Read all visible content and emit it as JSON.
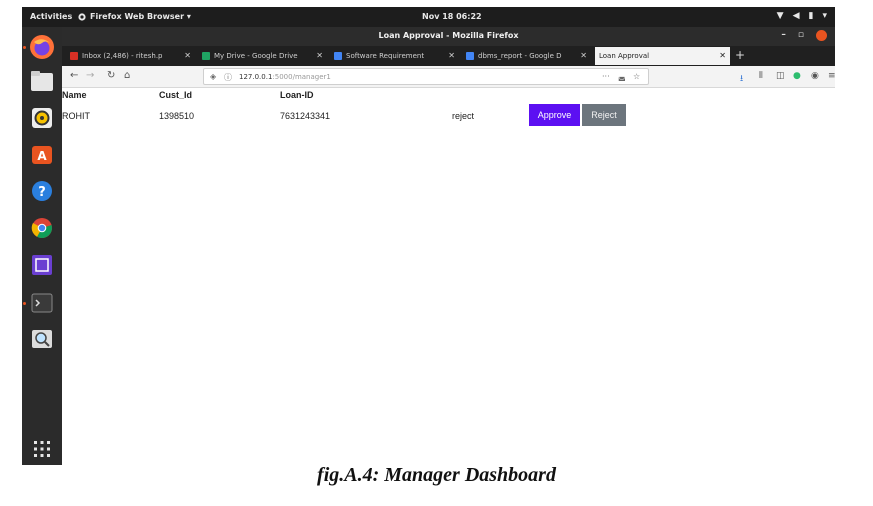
{
  "topbar": {
    "activities": "Activities",
    "app_menu": "Firefox Web Browser ▾",
    "clock": "Nov 18  06:22"
  },
  "window": {
    "title": "Loan Approval - Mozilla Firefox"
  },
  "tabs": [
    {
      "label": "Inbox (2,486) - ritesh.p",
      "favicon_color": "#d93025"
    },
    {
      "label": "My Drive - Google Drive",
      "favicon_color": "#1fa463"
    },
    {
      "label": "Software Requirement",
      "favicon_color": "#4285f4"
    },
    {
      "label": "dbms_report - Google D",
      "favicon_color": "#4285f4"
    },
    {
      "label": "Loan Approval",
      "favicon_color": "#f3f3f3"
    }
  ],
  "address_bar": {
    "host": "127.0.0.1",
    "path": ":5000/manager1"
  },
  "table": {
    "headers": [
      "Name",
      "Cust_Id",
      "Loan-ID"
    ],
    "row": {
      "name": "ROHIT",
      "cust_id": "1398510",
      "loan_id": "7631243341",
      "status": "reject"
    }
  },
  "actions": {
    "approve": "Approve",
    "reject": "Reject"
  },
  "caption": "fig.A.4: Manager Dashboard",
  "colors": {
    "approve": "#5c10f2",
    "reject": "#6c757d",
    "ubuntu_accent": "#e95420"
  }
}
